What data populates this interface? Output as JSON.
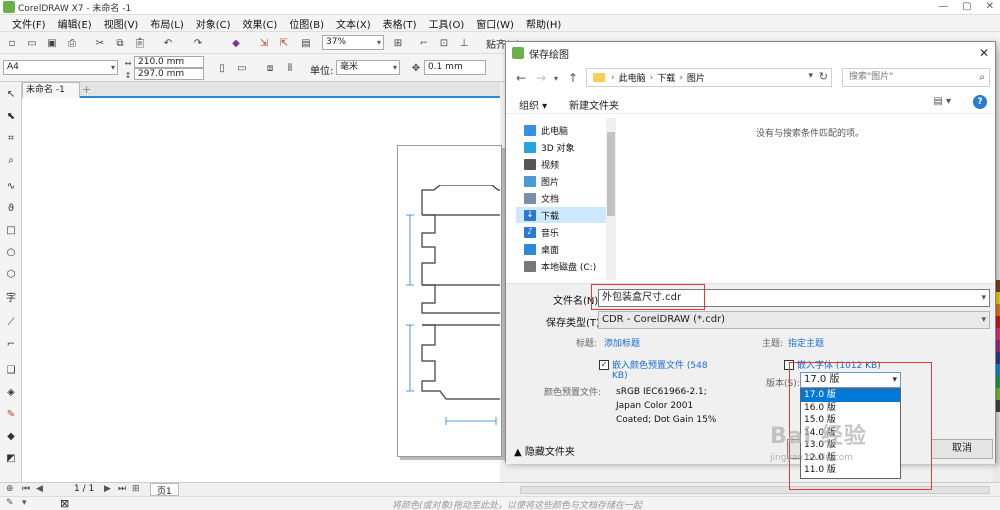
{
  "app": {
    "title": "CorelDRAW X7 - 未命名 -1",
    "window_buttons": [
      "—",
      "▢",
      "✕"
    ],
    "brand_color": "#6ab04c",
    "accent_color": "#2a8bd4"
  },
  "menu": [
    "文件(F)",
    "编辑(E)",
    "视图(V)",
    "布局(L)",
    "对象(C)",
    "效果(C)",
    "位图(B)",
    "文本(X)",
    "表格(T)",
    "工具(O)",
    "窗口(W)",
    "帮助(H)"
  ],
  "toolbar": {
    "zoom": "37%",
    "paste_label": "贴齐(T)"
  },
  "propertybar": {
    "page_size": "A4",
    "width": "210.0 mm",
    "height": "297.0 mm",
    "units_label": "单位:",
    "units_value": "毫米",
    "nudge": "0.1 mm"
  },
  "document": {
    "tab_label": "未命名 -1",
    "add_tab": "+"
  },
  "statusbar": {
    "page_counter": "1 / 1",
    "page_tab": "页1",
    "hint": "将颜色(或对象)拖动至此处，以便将这些颜色与文档存储在一起"
  },
  "dialog": {
    "title": "保存绘图",
    "close": "✕",
    "breadcrumb": [
      "此电脑",
      "下载",
      "图片"
    ],
    "search_placeholder": "搜索\"图片\"",
    "organize": "组织 ▾",
    "new_folder": "新建文件夹",
    "nav_items": [
      {
        "label": "此电脑",
        "icon": "computer-icon",
        "color": "#3a8ee6"
      },
      {
        "label": "3D 对象",
        "icon": "cube-icon",
        "color": "#27a3e0"
      },
      {
        "label": "视频",
        "icon": "video-icon",
        "color": "#555555"
      },
      {
        "label": "图片",
        "icon": "picture-icon",
        "color": "#4a9ad8"
      },
      {
        "label": "文档",
        "icon": "document-icon",
        "color": "#7a8fa8"
      },
      {
        "label": "下载",
        "icon": "download-icon",
        "color": "#2a7bd0"
      },
      {
        "label": "音乐",
        "icon": "music-icon",
        "color": "#2a7bd0"
      },
      {
        "label": "桌面",
        "icon": "desktop-icon",
        "color": "#2a8bd4"
      },
      {
        "label": "本地磁盘 (C:)",
        "icon": "disk-icon",
        "color": "#777777"
      }
    ],
    "selected_nav": "下载",
    "empty_message": "没有与搜索条件匹配的项。",
    "filename_label": "文件名(N):",
    "filename_value": "外包装盒尺寸.cdr",
    "filetype_label": "保存类型(T):",
    "filetype_value": "CDR - CorelDRAW (*.cdr)",
    "title_label": "标题:",
    "title_link": "添加标题",
    "subject_label": "主题:",
    "subject_link": "指定主题",
    "embed_profile_line1": "嵌入颜色预置文件 (548",
    "embed_profile_line2": "KB)",
    "embed_profile_checked": true,
    "embed_fonts": "嵌入字体 (1012 KB)",
    "embed_fonts_checked": false,
    "profile_label": "颜色预置文件:",
    "profile_lines": [
      "sRGB IEC61966-2.1;",
      "Japan Color 2001",
      "Coated; Dot Gain 15%"
    ],
    "version_label": "版本(S):",
    "version_value": "17.0 版",
    "version_options": [
      "17.0 版",
      "16.0 版",
      "15.0 版",
      "14.0 版",
      "13.0 版",
      "12.0 版",
      "11.0 版"
    ],
    "hide_folders": "隐藏文件夹",
    "save_button": "保",
    "cancel_button": "取消"
  },
  "watermark": {
    "text": "Bai 经验",
    "url": "jingyan.baidu.com"
  }
}
